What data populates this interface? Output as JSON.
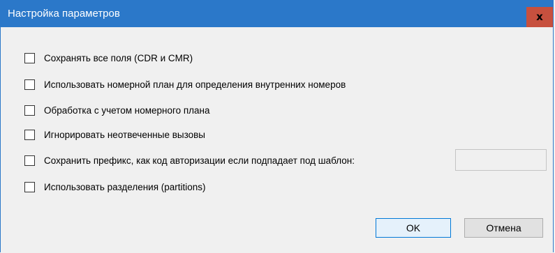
{
  "dialog": {
    "title": "Настройка параметров",
    "close_label": "x"
  },
  "options": [
    {
      "label": "Сохранять все поля (CDR и CMR)",
      "checked": false
    },
    {
      "label": "Использовать номерной план для определения внутренних номеров",
      "checked": false
    },
    {
      "label": "Обработка с учетом номерного плана",
      "checked": false
    },
    {
      "label": "Игнорировать неотвеченные вызовы",
      "checked": false
    },
    {
      "label": "Сохранить префикс, как код авторизации если подпадает под шаблон:",
      "checked": false
    },
    {
      "label": "Использовать разделения (partitions)",
      "checked": false
    }
  ],
  "pattern_input": {
    "value": "",
    "enabled": false
  },
  "buttons": {
    "ok_label": "OK",
    "cancel_label": "Отмена"
  },
  "colors": {
    "titlebar": "#2b78c9",
    "close_button": "#c7503e",
    "background": "#f0f0f0"
  }
}
